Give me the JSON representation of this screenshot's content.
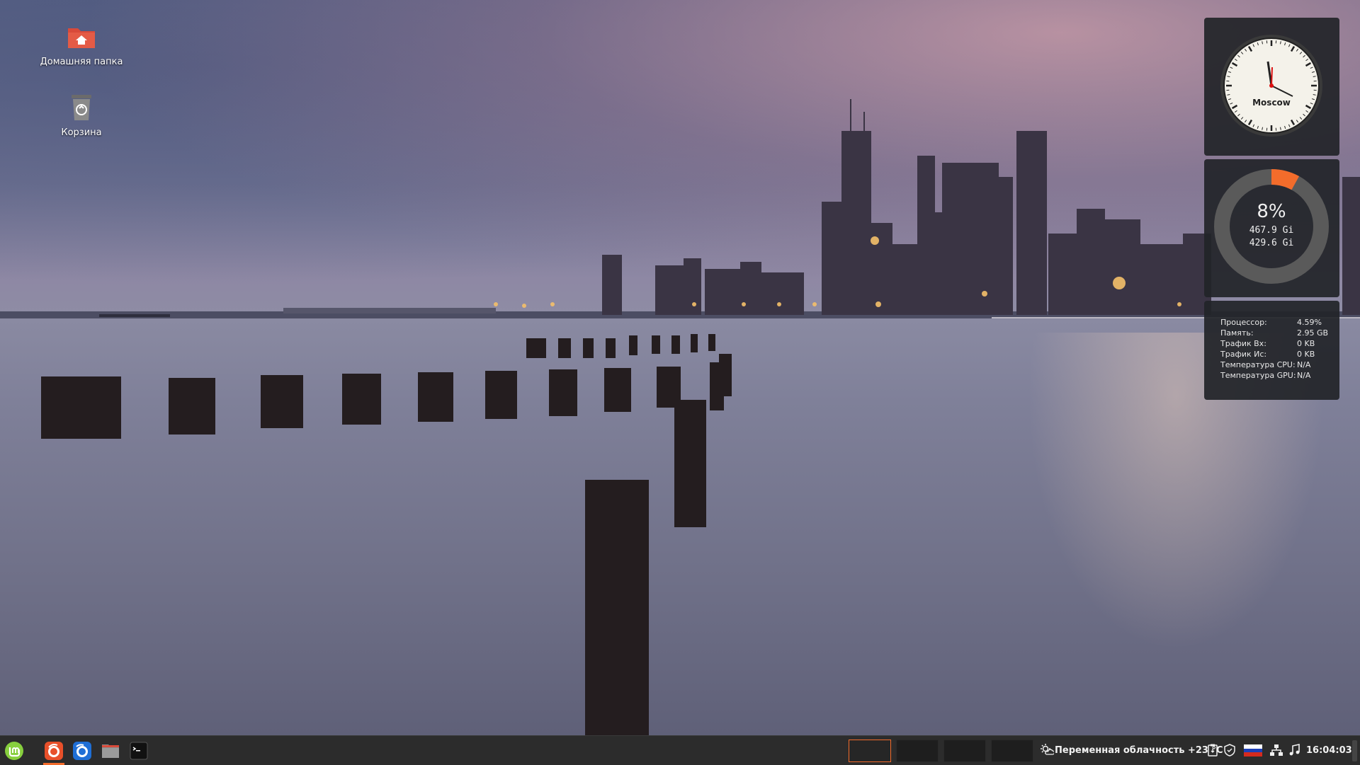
{
  "desktop": {
    "icons": [
      {
        "label": "Домашняя папка",
        "icon": "home-folder-icon"
      },
      {
        "label": "Корзина",
        "icon": "trash-icon"
      }
    ]
  },
  "widgets": {
    "clock": {
      "city": "Moscow",
      "time": "16:04:03"
    },
    "disk": {
      "percent": "8%",
      "total": "467.9 Gi",
      "free": "429.6 Gi",
      "fraction": 0.08,
      "accent": "#f36c2b"
    },
    "stats": [
      {
        "label": "Процессор:",
        "value": "4.59%"
      },
      {
        "label": "Память:",
        "value": "2.95 GB"
      },
      {
        "label": "Трафик Вх:",
        "value": "0 KB"
      },
      {
        "label": "Трафик Ис:",
        "value": "0 KB"
      },
      {
        "label": "Температура CPU:",
        "value": "N/A"
      },
      {
        "label": "Температура GPU:",
        "value": "N/A"
      }
    ]
  },
  "taskbar": {
    "apps": [
      {
        "name": "menu-button",
        "icon": "linux-mint-icon"
      },
      {
        "name": "firefox",
        "icon": "firefox-icon",
        "active": true
      },
      {
        "name": "thunderbird",
        "icon": "thunderbird-icon"
      },
      {
        "name": "files",
        "icon": "folder-icon"
      },
      {
        "name": "terminal",
        "icon": "terminal-icon"
      }
    ],
    "weather": "Переменная облачность +23 °C",
    "time": "16:04:03",
    "accent": "#f36c2b"
  }
}
